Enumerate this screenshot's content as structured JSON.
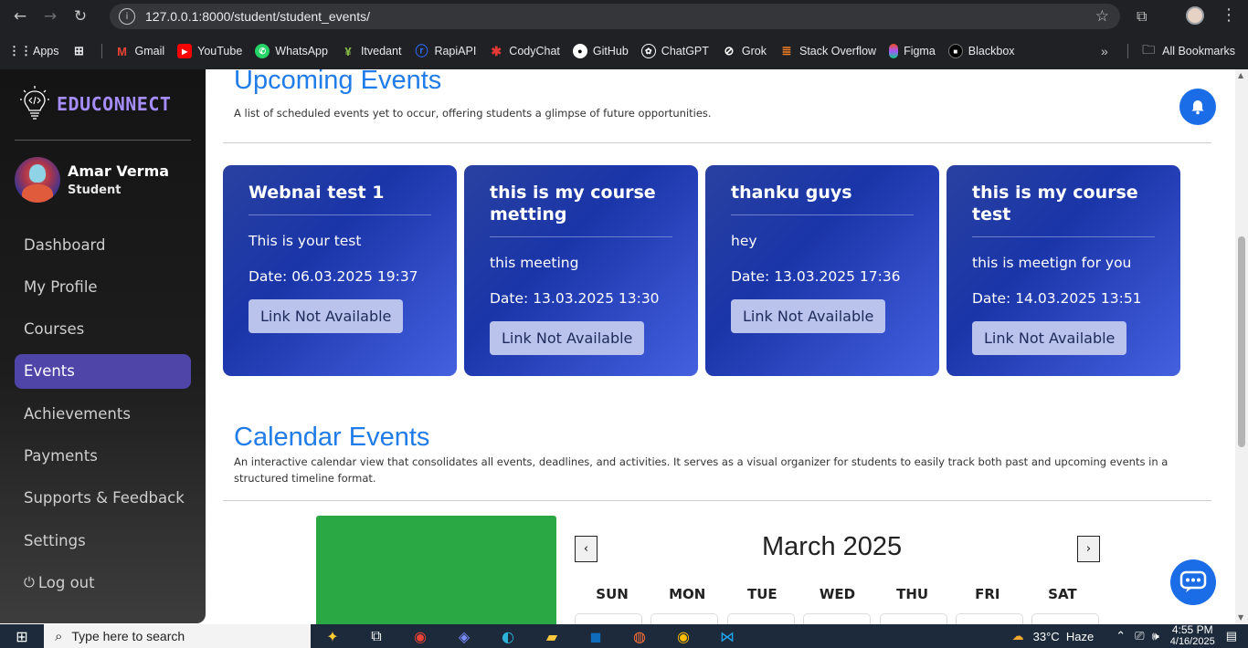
{
  "browser": {
    "url": "127.0.0.1:8000/student/student_events/",
    "bookmarks": [
      {
        "label": "Apps",
        "icon": "apps-grid-icon",
        "color": "#4285f4"
      },
      {
        "label": "Gmail",
        "icon": "gmail-icon",
        "color": "#ea4335"
      },
      {
        "label": "YouTube",
        "icon": "youtube-icon",
        "color": "#ff0000"
      },
      {
        "label": "WhatsApp",
        "icon": "whatsapp-icon",
        "color": "#25d366"
      },
      {
        "label": "Itvedant",
        "icon": "itvedant-icon",
        "color": "#8bc34a"
      },
      {
        "label": "RapiAPI",
        "icon": "rapiapi-icon",
        "color": "#0055ff"
      },
      {
        "label": "CodyChat",
        "icon": "codychat-icon",
        "color": "#e53935"
      },
      {
        "label": "GitHub",
        "icon": "github-icon",
        "color": "#ffffff"
      },
      {
        "label": "ChatGPT",
        "icon": "chatgpt-icon",
        "color": "#ffffff"
      },
      {
        "label": "Grok",
        "icon": "grok-icon",
        "color": "#ffffff"
      },
      {
        "label": "Stack Overflow",
        "icon": "stackoverflow-icon",
        "color": "#f48024"
      },
      {
        "label": "Figma",
        "icon": "figma-icon",
        "color": "#a259ff"
      },
      {
        "label": "Blackbox",
        "icon": "blackbox-icon",
        "color": "#000000"
      }
    ],
    "all_bookmarks": "All Bookmarks"
  },
  "sidebar": {
    "logo_text": "EDUCONNECT",
    "user_name": "Amar Verma",
    "user_role": "Student",
    "items": [
      {
        "label": "Dashboard",
        "active": false
      },
      {
        "label": "My Profile",
        "active": false
      },
      {
        "label": "Courses",
        "active": false
      },
      {
        "label": "Events",
        "active": true
      },
      {
        "label": "Achievements",
        "active": false
      },
      {
        "label": "Payments",
        "active": false
      },
      {
        "label": "Supports & Feedback",
        "active": false
      },
      {
        "label": "Settings",
        "active": false
      },
      {
        "label": "Log out",
        "active": false,
        "icon": "power-icon"
      }
    ]
  },
  "upcoming": {
    "title": "Upcoming Events",
    "description": "A list of scheduled events yet to occur, offering students a glimpse of future opportunities.",
    "cards": [
      {
        "title": "Webnai test 1",
        "description": "This is your test",
        "date": "Date: 06.03.2025 19:37",
        "button": "Link Not Available"
      },
      {
        "title": "this is my course metting",
        "description": "this meeting",
        "date": "Date: 13.03.2025 13:30",
        "button": "Link Not Available"
      },
      {
        "title": "thanku guys",
        "description": "hey",
        "date": "Date: 13.03.2025 17:36",
        "button": "Link Not Available"
      },
      {
        "title": "this is my course test",
        "description": "this is meetign for you",
        "date": "Date: 14.03.2025 13:51",
        "button": "Link Not Available"
      }
    ]
  },
  "calendar": {
    "title": "Calendar Events",
    "description": "An interactive calendar view that consolidates all events, deadlines, and activities. It serves as a visual organizer for students to easily track both past and upcoming events in a structured timeline format.",
    "month": "March 2025",
    "prev": "‹",
    "next": "›",
    "weekdays": [
      "SUN",
      "MON",
      "TUE",
      "WED",
      "THU",
      "FRI",
      "SAT"
    ]
  },
  "taskbar": {
    "search_placeholder": "Type here to search",
    "weather": "33°C  Haze",
    "time": "4:55 PM",
    "date": "4/16/2025"
  },
  "colors": {
    "accent": "#1f7ce8",
    "card_bg": "#1a35a8",
    "sidebar_active": "#4f45a9",
    "logo": "#a58dfc",
    "green_block": "#2aa843"
  }
}
